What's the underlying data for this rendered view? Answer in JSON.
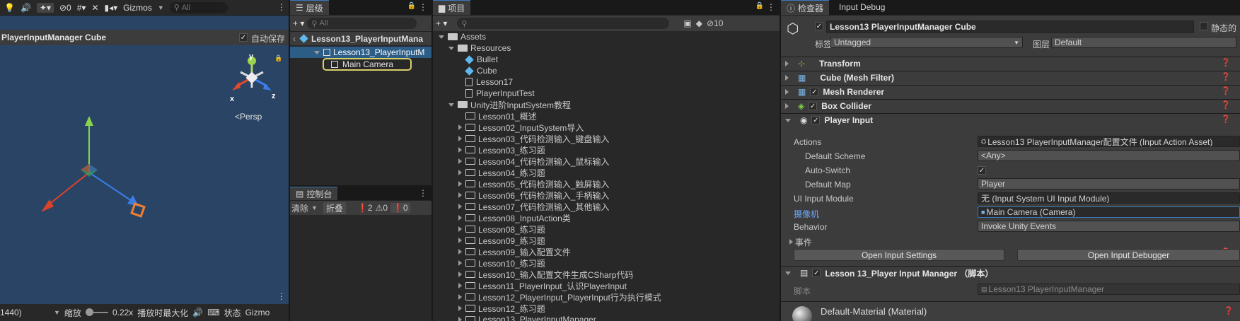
{
  "scene": {
    "title": "PlayerInputManager Cube",
    "autosave_label": "自动保存",
    "toolbar": {
      "gizmos": "Gizmos",
      "search_placeholder": "All",
      "hidden_count": "0"
    },
    "persp_label": "<Persp",
    "axis_y": "y",
    "axis_x": "x",
    "axis_z": "z",
    "bottom": {
      "resolution": "1440)",
      "scale_label": "缩放",
      "scale_value": "0.22x",
      "maximize_label": "播放时最大化",
      "stats_label": "状态",
      "gizmos_label": "Gizmo"
    }
  },
  "hierarchy": {
    "tab": "层级",
    "search_placeholder": "All",
    "scene_name": "Lesson13_PlayerInputMana",
    "items": [
      "Lesson13_PlayerInputM",
      "Main Camera"
    ]
  },
  "console": {
    "tab": "控制台",
    "clear": "清除",
    "collapse": "折叠",
    "err_count": "2",
    "warn_count": "0",
    "info_count": "0"
  },
  "project": {
    "tab": "项目",
    "hidden_count": "10",
    "tree": [
      {
        "label": "Assets",
        "depth": 0,
        "kind": "folder-open"
      },
      {
        "label": "Resources",
        "depth": 1,
        "kind": "folder-open"
      },
      {
        "label": "Bullet",
        "depth": 2,
        "kind": "prefab"
      },
      {
        "label": "Cube",
        "depth": 2,
        "kind": "prefab"
      },
      {
        "label": "Lesson17",
        "depth": 2,
        "kind": "file"
      },
      {
        "label": "PlayerInputTest",
        "depth": 2,
        "kind": "file"
      },
      {
        "label": "Unity进阶InputSystem教程",
        "depth": 1,
        "kind": "folder-open"
      },
      {
        "label": "Lesson01_概述",
        "depth": 2,
        "kind": "folder"
      },
      {
        "label": "Lesson02_InputSystem导入",
        "depth": 2,
        "kind": "folder-closed"
      },
      {
        "label": "Lesson03_代码检测输入_键盘输入",
        "depth": 2,
        "kind": "folder-closed"
      },
      {
        "label": "Lesson03_练习题",
        "depth": 2,
        "kind": "folder-closed"
      },
      {
        "label": "Lesson04_代码检测输入_鼠标输入",
        "depth": 2,
        "kind": "folder-closed"
      },
      {
        "label": "Lesson04_练习题",
        "depth": 2,
        "kind": "folder-closed"
      },
      {
        "label": "Lesson05_代码检测输入_触屏输入",
        "depth": 2,
        "kind": "folder-closed"
      },
      {
        "label": "Lesson06_代码检测输入_手柄输入",
        "depth": 2,
        "kind": "folder-closed"
      },
      {
        "label": "Lesson07_代码检测输入_其他输入",
        "depth": 2,
        "kind": "folder-closed"
      },
      {
        "label": "Lesson08_InputAction类",
        "depth": 2,
        "kind": "folder-closed"
      },
      {
        "label": "Lesson08_练习题",
        "depth": 2,
        "kind": "folder-closed"
      },
      {
        "label": "Lesson09_练习题",
        "depth": 2,
        "kind": "folder-closed"
      },
      {
        "label": "Lesson09_输入配置文件",
        "depth": 2,
        "kind": "folder-closed"
      },
      {
        "label": "Lesson10_练习题",
        "depth": 2,
        "kind": "folder-closed"
      },
      {
        "label": "Lesson10_输入配置文件生成CSharp代码",
        "depth": 2,
        "kind": "folder-closed"
      },
      {
        "label": "Lesson11_PlayerInput_认识PlayerInput",
        "depth": 2,
        "kind": "folder-closed"
      },
      {
        "label": "Lesson12_PlayerInput_PlayerInput行为执行模式",
        "depth": 2,
        "kind": "folder-closed"
      },
      {
        "label": "Lesson12_练习题",
        "depth": 2,
        "kind": "folder-closed"
      },
      {
        "label": "Lesson13_PlayerInputManager",
        "depth": 2,
        "kind": "folder-closed"
      }
    ]
  },
  "inspector": {
    "tabs": [
      "检查器",
      "Input Debug"
    ],
    "object_name": "Lesson13 PlayerInputManager Cube",
    "static_label": "静态的",
    "tag_label": "标签",
    "tag_value": "Untagged",
    "layer_label": "图层",
    "layer_value": "Default",
    "components": [
      "Transform",
      "Cube (Mesh Filter)",
      "Mesh Renderer",
      "Box Collider",
      "Player Input"
    ],
    "player_input": {
      "actions_label": "Actions",
      "actions_value": "Lesson13 PlayerInputManager配置文件 (Input Action Asset)",
      "scheme_label": "Default Scheme",
      "scheme_value": "<Any>",
      "autoswitch_label": "Auto-Switch",
      "map_label": "Default Map",
      "map_value": "Player",
      "uimodule_label": "UI Input Module",
      "uimodule_value": "无 (Input System UI Input Module)",
      "camera_label": "摄像机",
      "camera_value": "Main Camera (Camera)",
      "behavior_label": "Behavior",
      "behavior_value": "Invoke Unity Events",
      "events_label": "事件",
      "open_settings": "Open Input Settings",
      "open_debugger": "Open Input Debugger"
    },
    "script_component": "Lesson 13_Player Input Manager （脚本）",
    "script_label": "脚本",
    "script_value": "Lesson13 PlayerInputManager",
    "material": "Default-Material (Material)"
  },
  "colors": {
    "accent": "#3a79bb",
    "scene_bg": "#2b4766",
    "highlight": "#d9cf6a",
    "link": "#6ea8ff"
  }
}
